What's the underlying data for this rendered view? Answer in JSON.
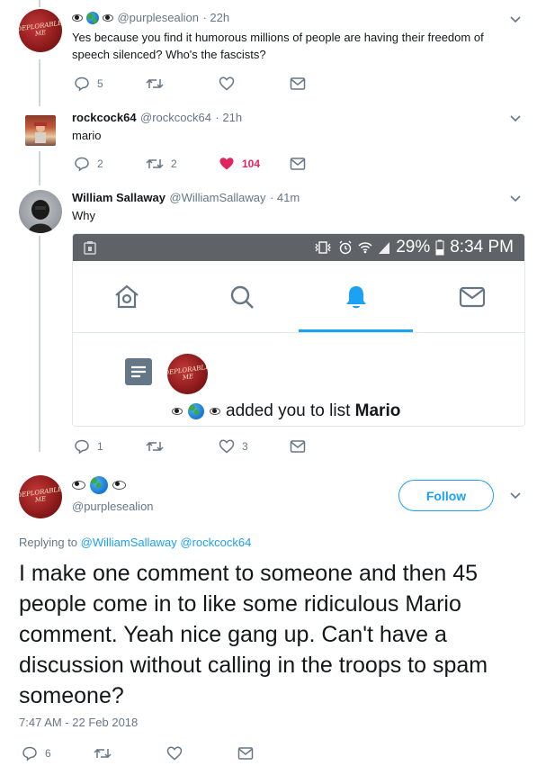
{
  "tweets": [
    {
      "avatar_text": "DEPLORABLE\nME",
      "handle": "@purplesealion",
      "time": "· 22h",
      "text": "Yes because you find it humorous millions of people are having their freedom of speech silenced? Who's the fascists?",
      "reply_count": "5",
      "retweet_count": "",
      "like_count": ""
    },
    {
      "name": "rockcock64",
      "handle": "@rockcock64",
      "time": "· 21h",
      "text": "mario",
      "reply_count": "2",
      "retweet_count": "2",
      "like_count": "104",
      "liked": true
    },
    {
      "name": "William Sallaway",
      "handle": "@WilliamSallaway",
      "time": "· 41m",
      "text": "Why",
      "reply_count": "1",
      "retweet_count": "",
      "like_count": "3",
      "embed": {
        "battery": "29%",
        "clock": "8:34 PM",
        "notification_text": "added you to list ",
        "list_name": "Mario",
        "avatar_text": "DEPLORABLE\nME"
      }
    }
  ],
  "focused_tweet": {
    "avatar_text": "DEPLORABLE\nME",
    "handle": "@purplesealion",
    "follow_label": "Follow",
    "replying_to_label": "Replying to ",
    "replying_to_1": "@WilliamSallaway",
    "replying_to_2": "@rockcock64",
    "text": "I make one comment to someone and then 45 people come in to like some ridiculous Mario comment. Yeah nice gang up. Can't have a discussion without calling in the troops to spam someone?",
    "timestamp": "7:47 AM - 22 Feb 2018",
    "reply_count": "6"
  },
  "colors": {
    "accent": "#1da1f2",
    "like": "#e0245e",
    "muted": "#657786"
  }
}
